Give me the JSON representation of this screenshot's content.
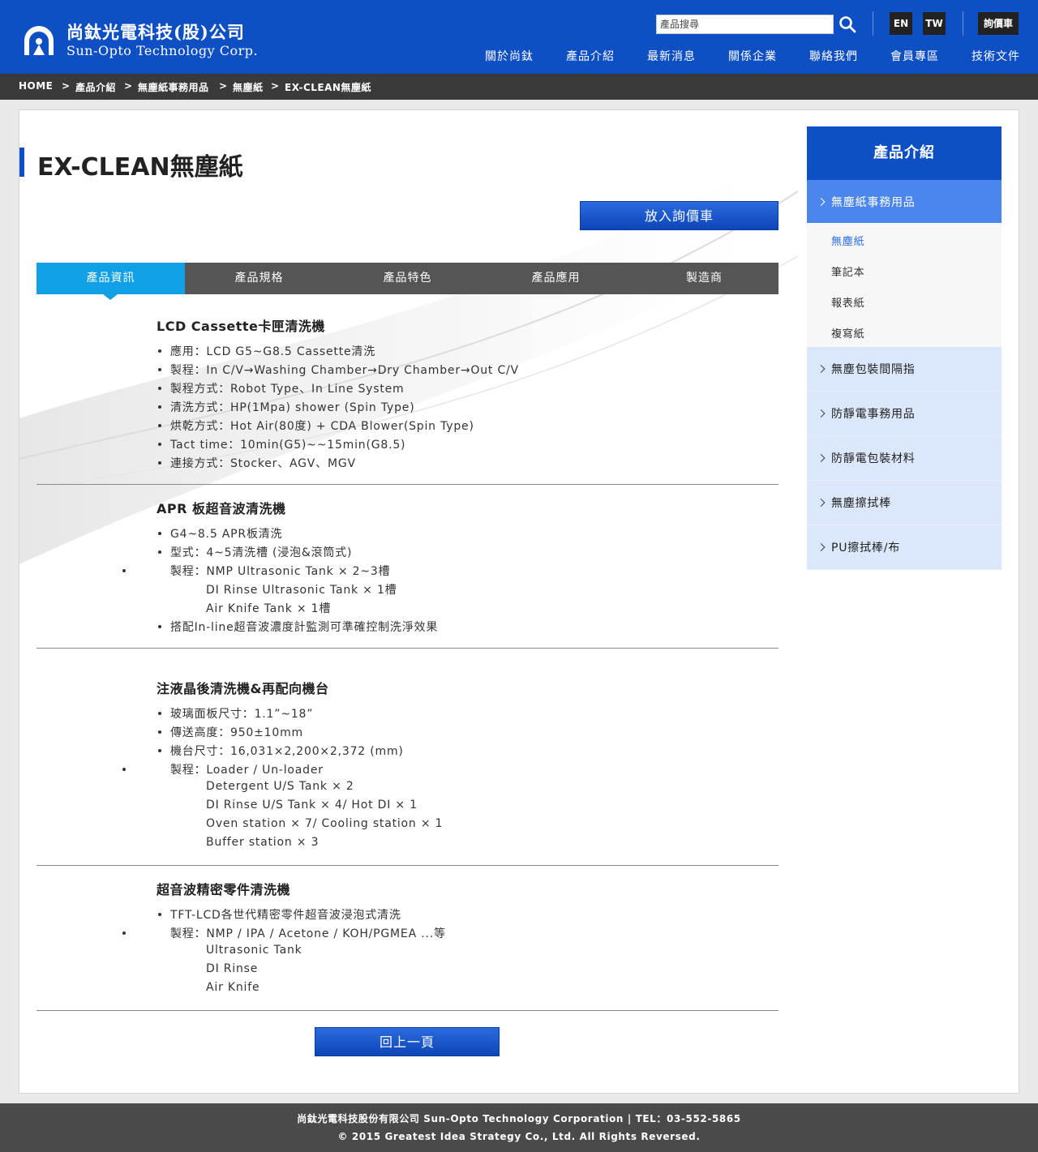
{
  "header": {
    "company_cn": "尚鈦光電科技(股)公司",
    "company_en": "Sun-Opto Technology Corp.",
    "search_placeholder": "產品搜尋",
    "lang_en": "EN",
    "lang_tw": "TW",
    "cart_label": "詢價車",
    "brand_color": "#0f4fc4",
    "nav": [
      "關於尚鈦",
      "產品介紹",
      "最新消息",
      "關係企業",
      "聯絡我們",
      "會員專區",
      "技術文件"
    ]
  },
  "breadcrumb": {
    "items": [
      "HOME",
      "產品介紹",
      "無塵紙事務用品",
      "無塵紙",
      "EX-CLEAN無塵紙"
    ],
    "separator": ">"
  },
  "main": {
    "title": "EX-CLEAN無塵紙",
    "inquiry_button": "放入詢價車",
    "tabs": [
      "產品資訊",
      "產品規格",
      "產品特色",
      "產品應用",
      "製造商"
    ],
    "active_tab": "產品資訊",
    "sections": [
      {
        "title": "LCD Cassette卡匣清洗機",
        "lines": [
          "應用：LCD G5~G8.5 Cassette清洗",
          "製程：In C/V→Washing Chamber→Dry Chamber→Out C/V",
          "製程方式：Robot Type、In Line System",
          "清洗方式：HP(1Mpa) shower (Spin Type)",
          "烘乾方式：Hot Air(80度) + CDA Blower(Spin Type)",
          "Tact time：10min(G5)~~15min(G8.5)",
          "連接方式：Stocker、AGV、MGV"
        ]
      },
      {
        "title": "APR 板超音波清洗機",
        "lines": [
          "G4~8.5 APR板清洗",
          "型式：4~5清洗槽 (浸泡&滾筒式)",
          "製程：NMP Ultrasonic Tank × 2~3槽",
          "DI Rinse Ultrasonic Tank × 1槽",
          "Air Knife Tank × 1槽",
          "搭配In-line超音波濃度計監測可準確控制洗淨效果"
        ]
      },
      {
        "title": "注液晶後清洗機&再配向機台",
        "lines": [
          "玻璃面板尺寸：1.1”~18”",
          "傳送高度：950±10mm",
          "機台尺寸：16,031×2,200×2,372 (mm)",
          "製程：Loader / Un-loader",
          "Detergent U/S Tank × 2",
          "DI Rinse U/S Tank × 4/ Hot DI × 1",
          "Oven station × 7/ Cooling station × 1",
          "Buffer station × 3"
        ]
      },
      {
        "title": "超音波精密零件清洗機",
        "lines": [
          "TFT-LCD各世代精密零件超音波浸泡式清洗",
          "製程：NMP / IPA / Acetone / KOH/PGMEA ...等",
          "Ultrasonic Tank",
          "DI Rinse",
          "Air Knife"
        ]
      }
    ],
    "back_button": "回上一頁"
  },
  "sidebar": {
    "heading": "產品介紹",
    "active_category": "無塵紙事務用品",
    "subitems": [
      "無塵紙",
      "筆記本",
      "報表紙",
      "複寫紙"
    ],
    "active_subitem": "無塵紙",
    "categories": [
      "無塵包裝間隔指",
      "防靜電事務用品",
      "防靜電包裝材料",
      "無塵擦拭棒",
      "PU擦拭棒/布"
    ]
  },
  "footer": {
    "line1": "尚鈦光電科技股份有限公司 Sun-Opto Technology Corporation | TEL：03-552-5865",
    "line2": "© 2015 Greatest Idea Strategy Co., Ltd. All Rights Reversed."
  }
}
